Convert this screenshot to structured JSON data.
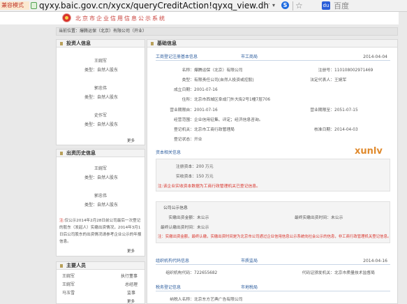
{
  "browser": {
    "badge": "兼容模式",
    "url": "qyxy.baic.gov.cn/xycx/queryCreditAction!qyxq_view.dhtml?r",
    "dropdown": "▾",
    "search_glyph": "S",
    "star": "☆",
    "baidu_glyph": "du",
    "baidu_text": "百度"
  },
  "site": {
    "title": "北京市企业信用信息公示系统"
  },
  "breadcrumb": "当前位置：爆腾运保（北京）有限公司（开业）",
  "investors": {
    "title": "投资人信息",
    "people": [
      {
        "name": "王婉军",
        "type": "类型：自然人股东"
      },
      {
        "name": "郭忠伟",
        "type": "类型：自然人股东"
      },
      {
        "name": "史作军",
        "type": "类型：自然人股东"
      }
    ],
    "more": "更多"
  },
  "invest_history": {
    "title": "出资历史信息",
    "people": [
      {
        "name": "王婉军",
        "type": "类型：自然人股东"
      },
      {
        "name": "郭忠伟",
        "type": "类型：自然人股东"
      }
    ],
    "note_prefix": "注:",
    "note": "仅公示2014年2月28日前公司最后一次登记的股东（发起人）实缴出资情况，2014年3月1日后公司股东的出资情况请参考企业公示的年报信息。",
    "more": "更多"
  },
  "key_staff": {
    "title": "主要人员",
    "rows": [
      {
        "name": "王婉军",
        "role": "执行董事"
      },
      {
        "name": "王婉军",
        "role": "总经理"
      },
      {
        "name": "马玉雪",
        "role": "监事"
      }
    ],
    "more": "更多"
  },
  "basic": {
    "title": "基础信息",
    "reg_bar": {
      "left": "工商登记注册基本信息",
      "mid": "市工商局",
      "right": "2014-04-04"
    },
    "name_label": "名称：",
    "name_value": "爆腾运保（北京）有限公司",
    "regno_label": "注册号：",
    "regno_value": "110108002971469",
    "type_label": "类型：",
    "type_value": "有限责任公司(自然人投资或控股)",
    "legal_label": "法定代表人：",
    "legal_value": "王婉军",
    "estab_label": "成立日期：",
    "estab_value": "2001-07-16",
    "addr_label": "住所：",
    "addr_value": "北京市西城区阜成门外大街2号1幢7层706",
    "from_label": "营业期限自：",
    "from_value": "2001-07-16",
    "to_label": "营业期限至：",
    "to_value": "2051-07-15",
    "scope_label": "经营范围：",
    "scope_value": "企业信用征集、评定；经济信息咨询。",
    "auth_label": "登记机关：",
    "auth_value": "北京市工商行政管理局",
    "approve_label": "核准日期：",
    "approve_value": "2014-04-03",
    "status_label": "登记状态：",
    "status_value": "开业"
  },
  "capital": {
    "bar": "资本相关信息",
    "reg_label": "注册资本：",
    "reg_value": "200 万元",
    "paid_label": "实收资本：",
    "paid_value": "150 万元",
    "note": "注:该企业实收资本数据为工商行政管理机关已登记信息。"
  },
  "public": {
    "bar": "公司公示信息",
    "paid_label": "实缴出资金额：",
    "paid_value": "未公示",
    "latest_label": "最终实缴出资时间：",
    "latest_value": "未公示",
    "final_label": "最终认缴出资时间：",
    "final_value": "未公示",
    "note": "注：实缴出资金额，最终认缴，实缴出资时间是为北京市公司通过企业信用信息公示系统向社会公示的信息，非工商行政管理机关登记信息。"
  },
  "orgcode": {
    "bar": {
      "left": "组织机构代码信息",
      "mid": "市质监局",
      "right": "2014-04-16"
    },
    "code_label": "组织机构代码：",
    "code_value": "722655682",
    "issuer_label": "代码证颁发机关：",
    "issuer_value": "北京市质量技术监督局"
  },
  "tax": {
    "bar": {
      "left": "税务登记信息",
      "mid": "市地税局"
    },
    "name_label": "纳税人名称：",
    "name_value": "北京东方艺典广告有限公司"
  },
  "watermark": "xunlv",
  "colors": {
    "accent_red": "#d9342b",
    "link_blue": "#2f5f9f",
    "header_red": "#c9403b"
  }
}
